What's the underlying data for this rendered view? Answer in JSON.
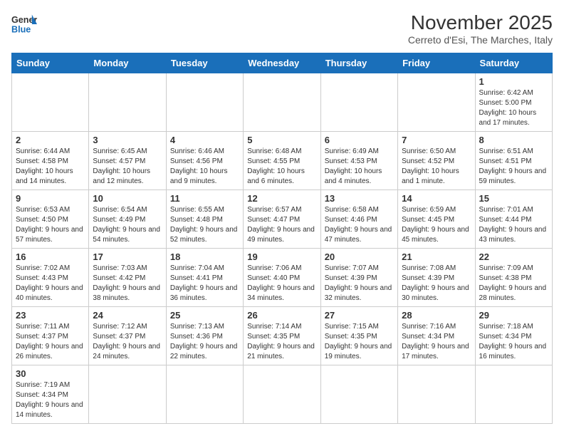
{
  "logo": {
    "line1": "General",
    "line2": "Blue"
  },
  "title": "November 2025",
  "subtitle": "Cerreto d'Esi, The Marches, Italy",
  "days_of_week": [
    "Sunday",
    "Monday",
    "Tuesday",
    "Wednesday",
    "Thursday",
    "Friday",
    "Saturday"
  ],
  "weeks": [
    [
      {
        "day": "",
        "info": ""
      },
      {
        "day": "",
        "info": ""
      },
      {
        "day": "",
        "info": ""
      },
      {
        "day": "",
        "info": ""
      },
      {
        "day": "",
        "info": ""
      },
      {
        "day": "",
        "info": ""
      },
      {
        "day": "1",
        "info": "Sunrise: 6:42 AM\nSunset: 5:00 PM\nDaylight: 10 hours and 17 minutes."
      }
    ],
    [
      {
        "day": "2",
        "info": "Sunrise: 6:44 AM\nSunset: 4:58 PM\nDaylight: 10 hours and 14 minutes."
      },
      {
        "day": "3",
        "info": "Sunrise: 6:45 AM\nSunset: 4:57 PM\nDaylight: 10 hours and 12 minutes."
      },
      {
        "day": "4",
        "info": "Sunrise: 6:46 AM\nSunset: 4:56 PM\nDaylight: 10 hours and 9 minutes."
      },
      {
        "day": "5",
        "info": "Sunrise: 6:48 AM\nSunset: 4:55 PM\nDaylight: 10 hours and 6 minutes."
      },
      {
        "day": "6",
        "info": "Sunrise: 6:49 AM\nSunset: 4:53 PM\nDaylight: 10 hours and 4 minutes."
      },
      {
        "day": "7",
        "info": "Sunrise: 6:50 AM\nSunset: 4:52 PM\nDaylight: 10 hours and 1 minute."
      },
      {
        "day": "8",
        "info": "Sunrise: 6:51 AM\nSunset: 4:51 PM\nDaylight: 9 hours and 59 minutes."
      }
    ],
    [
      {
        "day": "9",
        "info": "Sunrise: 6:53 AM\nSunset: 4:50 PM\nDaylight: 9 hours and 57 minutes."
      },
      {
        "day": "10",
        "info": "Sunrise: 6:54 AM\nSunset: 4:49 PM\nDaylight: 9 hours and 54 minutes."
      },
      {
        "day": "11",
        "info": "Sunrise: 6:55 AM\nSunset: 4:48 PM\nDaylight: 9 hours and 52 minutes."
      },
      {
        "day": "12",
        "info": "Sunrise: 6:57 AM\nSunset: 4:47 PM\nDaylight: 9 hours and 49 minutes."
      },
      {
        "day": "13",
        "info": "Sunrise: 6:58 AM\nSunset: 4:46 PM\nDaylight: 9 hours and 47 minutes."
      },
      {
        "day": "14",
        "info": "Sunrise: 6:59 AM\nSunset: 4:45 PM\nDaylight: 9 hours and 45 minutes."
      },
      {
        "day": "15",
        "info": "Sunrise: 7:01 AM\nSunset: 4:44 PM\nDaylight: 9 hours and 43 minutes."
      }
    ],
    [
      {
        "day": "16",
        "info": "Sunrise: 7:02 AM\nSunset: 4:43 PM\nDaylight: 9 hours and 40 minutes."
      },
      {
        "day": "17",
        "info": "Sunrise: 7:03 AM\nSunset: 4:42 PM\nDaylight: 9 hours and 38 minutes."
      },
      {
        "day": "18",
        "info": "Sunrise: 7:04 AM\nSunset: 4:41 PM\nDaylight: 9 hours and 36 minutes."
      },
      {
        "day": "19",
        "info": "Sunrise: 7:06 AM\nSunset: 4:40 PM\nDaylight: 9 hours and 34 minutes."
      },
      {
        "day": "20",
        "info": "Sunrise: 7:07 AM\nSunset: 4:39 PM\nDaylight: 9 hours and 32 minutes."
      },
      {
        "day": "21",
        "info": "Sunrise: 7:08 AM\nSunset: 4:39 PM\nDaylight: 9 hours and 30 minutes."
      },
      {
        "day": "22",
        "info": "Sunrise: 7:09 AM\nSunset: 4:38 PM\nDaylight: 9 hours and 28 minutes."
      }
    ],
    [
      {
        "day": "23",
        "info": "Sunrise: 7:11 AM\nSunset: 4:37 PM\nDaylight: 9 hours and 26 minutes."
      },
      {
        "day": "24",
        "info": "Sunrise: 7:12 AM\nSunset: 4:37 PM\nDaylight: 9 hours and 24 minutes."
      },
      {
        "day": "25",
        "info": "Sunrise: 7:13 AM\nSunset: 4:36 PM\nDaylight: 9 hours and 22 minutes."
      },
      {
        "day": "26",
        "info": "Sunrise: 7:14 AM\nSunset: 4:35 PM\nDaylight: 9 hours and 21 minutes."
      },
      {
        "day": "27",
        "info": "Sunrise: 7:15 AM\nSunset: 4:35 PM\nDaylight: 9 hours and 19 minutes."
      },
      {
        "day": "28",
        "info": "Sunrise: 7:16 AM\nSunset: 4:34 PM\nDaylight: 9 hours and 17 minutes."
      },
      {
        "day": "29",
        "info": "Sunrise: 7:18 AM\nSunset: 4:34 PM\nDaylight: 9 hours and 16 minutes."
      }
    ],
    [
      {
        "day": "30",
        "info": "Sunrise: 7:19 AM\nSunset: 4:34 PM\nDaylight: 9 hours and 14 minutes."
      },
      {
        "day": "",
        "info": ""
      },
      {
        "day": "",
        "info": ""
      },
      {
        "day": "",
        "info": ""
      },
      {
        "day": "",
        "info": ""
      },
      {
        "day": "",
        "info": ""
      },
      {
        "day": "",
        "info": ""
      }
    ]
  ]
}
